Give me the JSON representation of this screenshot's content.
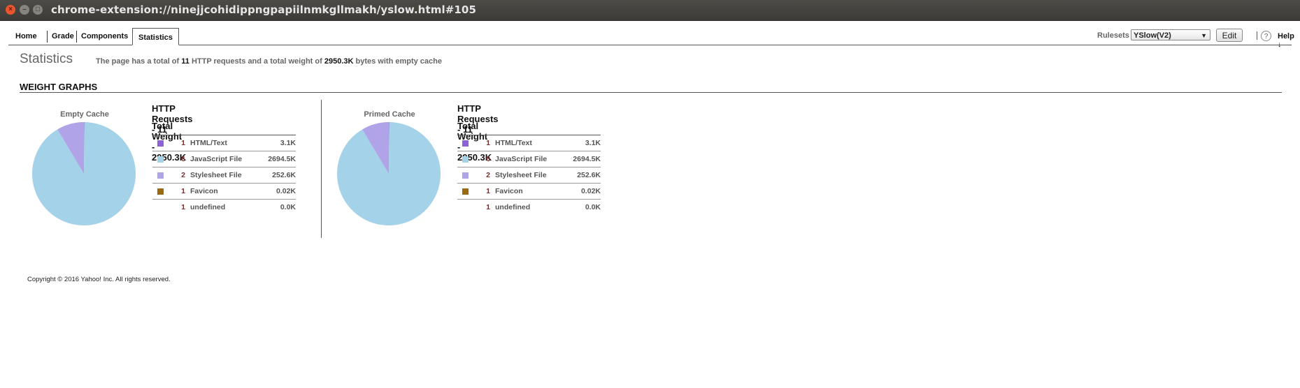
{
  "window": {
    "title": "chrome-extension://ninejjcohidippngpapiilnmkgllmakh/yslow.html#105"
  },
  "tabs": [
    {
      "label": "Home"
    },
    {
      "label": "Grade"
    },
    {
      "label": "Components"
    },
    {
      "label": "Statistics",
      "active": true
    }
  ],
  "toolbar": {
    "rulesets_label": "Rulesets",
    "ruleset_selected": "YSlow(V2)",
    "edit_label": "Edit",
    "help_label": "Help ↓",
    "help_icon": "?"
  },
  "header": {
    "title": "Statistics",
    "summary_prefix": "The page has a total of",
    "requests": "11",
    "summary_mid": "HTTP requests and a total weight of",
    "weight": "2950.3K",
    "summary_suffix": "bytes with empty cache"
  },
  "section": {
    "title": "WEIGHT GRAPHS"
  },
  "colors": {
    "html": "#8c62d6",
    "js": "#a4d2e8",
    "css": "#b0a3e8",
    "favicon": "#9a6a10",
    "undefined": "#ffffff"
  },
  "panels": [
    {
      "caption": "Empty Cache",
      "requests_heading": "HTTP Requests - 11",
      "weight_heading": "Total Weight - 2950.3K",
      "rows": [
        {
          "color": "#8c62d6",
          "count": "1",
          "label": "HTML/Text",
          "size": "3.1K"
        },
        {
          "color": "#a4d2e8",
          "count": "6",
          "label": "JavaScript File",
          "size": "2694.5K"
        },
        {
          "color": "#b0a3e8",
          "count": "2",
          "label": "Stylesheet File",
          "size": "252.6K"
        },
        {
          "color": "#9a6a10",
          "count": "1",
          "label": "Favicon",
          "size": "0.02K"
        },
        {
          "color": "",
          "count": "1",
          "label": "undefined",
          "size": "0.0K"
        }
      ]
    },
    {
      "caption": "Primed Cache",
      "requests_heading": "HTTP Requests - 11",
      "weight_heading": "Total Weight - 2950.3K",
      "rows": [
        {
          "color": "#8c62d6",
          "count": "1",
          "label": "HTML/Text",
          "size": "3.1K"
        },
        {
          "color": "#a4d2e8",
          "count": "6",
          "label": "JavaScript File",
          "size": "2694.5K"
        },
        {
          "color": "#b0a3e8",
          "count": "2",
          "label": "Stylesheet File",
          "size": "252.6K"
        },
        {
          "color": "#9a6a10",
          "count": "1",
          "label": "Favicon",
          "size": "0.02K"
        },
        {
          "color": "",
          "count": "1",
          "label": "undefined",
          "size": "0.0K"
        }
      ]
    }
  ],
  "chart_data": [
    {
      "type": "pie",
      "title": "Empty Cache",
      "categories": [
        "HTML/Text",
        "JavaScript File",
        "Stylesheet File",
        "Favicon",
        "undefined"
      ],
      "values": [
        3.1,
        2694.5,
        252.6,
        0.02,
        0.0
      ],
      "colors": [
        "#8c62d6",
        "#a4d2e8",
        "#b0a3e8",
        "#9a6a10",
        "#ffffff"
      ]
    },
    {
      "type": "pie",
      "title": "Primed Cache",
      "categories": [
        "HTML/Text",
        "JavaScript File",
        "Stylesheet File",
        "Favicon",
        "undefined"
      ],
      "values": [
        3.1,
        2694.5,
        252.6,
        0.02,
        0.0
      ],
      "colors": [
        "#8c62d6",
        "#a4d2e8",
        "#b0a3e8",
        "#9a6a10",
        "#ffffff"
      ]
    }
  ],
  "footer": {
    "copyright": "Copyright © 2016 Yahoo! Inc. All rights reserved."
  }
}
